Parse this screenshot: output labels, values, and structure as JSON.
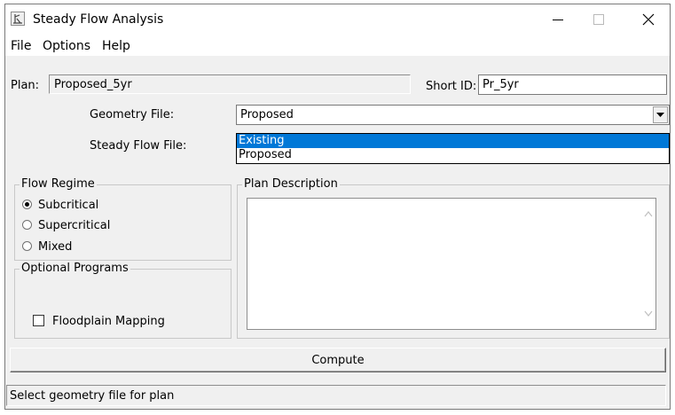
{
  "window": {
    "title": "Steady Flow Analysis",
    "app_icon": "hec-ras-icon"
  },
  "menu": [
    {
      "label": "File"
    },
    {
      "label": "Options"
    },
    {
      "label": "Help"
    }
  ],
  "plan": {
    "label": "Plan:",
    "value": "Proposed_5yr",
    "short_id_label": "Short ID:",
    "short_id_value": "Pr_5yr"
  },
  "geometry_file": {
    "label": "Geometry File:",
    "selected": "Proposed",
    "options": [
      "Existing",
      "Proposed"
    ],
    "highlighted": "Existing"
  },
  "steady_flow_file": {
    "label": "Steady Flow File:"
  },
  "flow_regime": {
    "title": "Flow Regime",
    "options": [
      "Subcritical",
      "Supercritical",
      "Mixed"
    ],
    "selected": "Subcritical"
  },
  "optional_programs": {
    "title": "Optional Programs",
    "floodplain_mapping_label": "Floodplain Mapping",
    "floodplain_mapping_checked": false
  },
  "plan_description": {
    "title": "Plan Description",
    "value": ""
  },
  "compute_button": "Compute",
  "status": "Select geometry file for plan",
  "colors": {
    "selection": "#0078d7",
    "window_bg": "#f0f0f0"
  }
}
